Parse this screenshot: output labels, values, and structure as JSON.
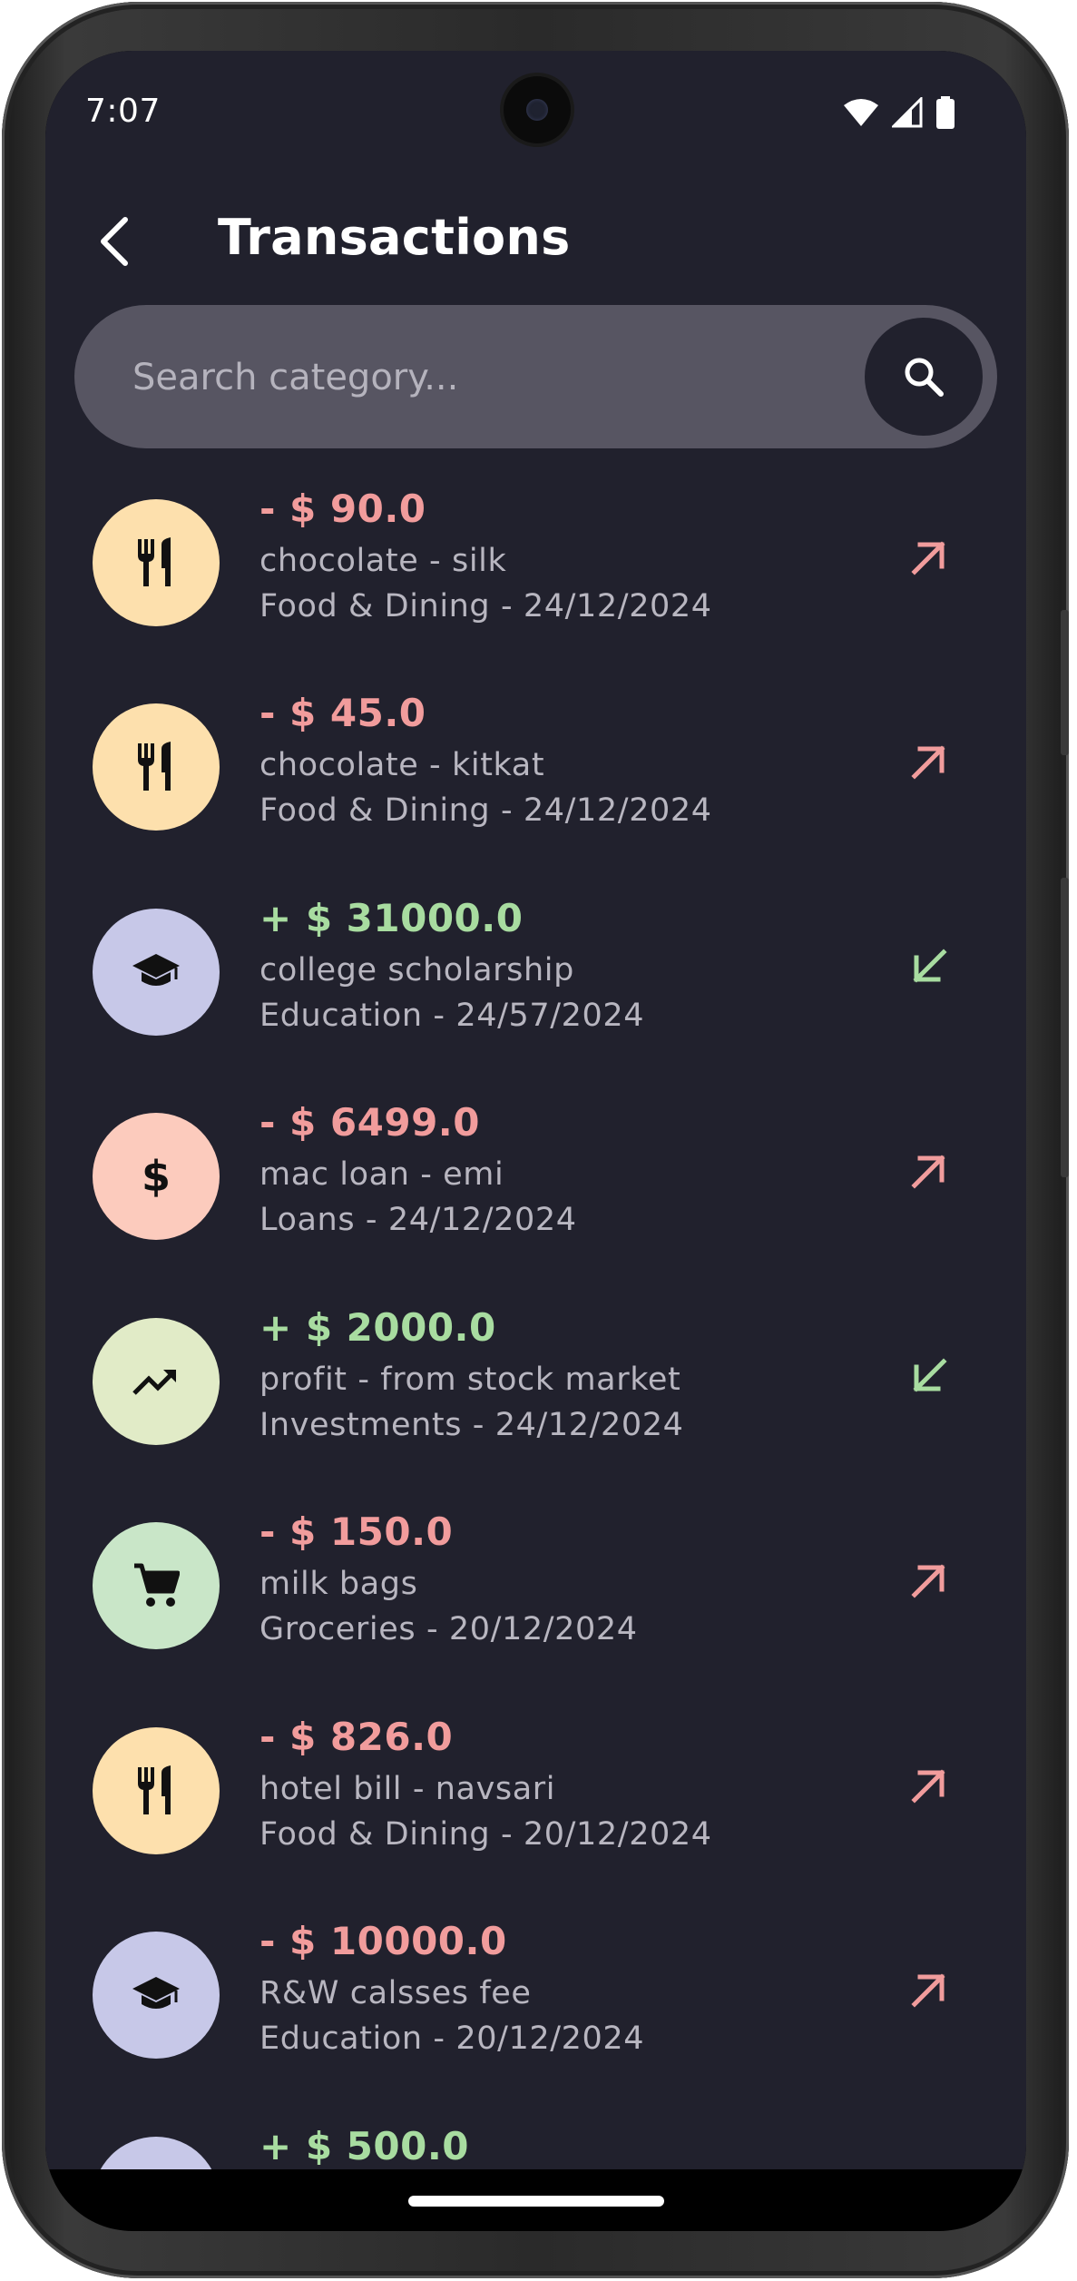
{
  "status": {
    "time": "7:07"
  },
  "header": {
    "title": "Transactions"
  },
  "search": {
    "placeholder": "Search category..."
  },
  "colors": {
    "background": "#21212d",
    "expense": "#f19c9c",
    "income": "#a8dca0",
    "food": "#fde0ad",
    "education": "#c7c8e8",
    "loans": "#fccbbd",
    "investments": "#e1ebc7",
    "groceries": "#c9e6c8"
  },
  "transactions": [
    {
      "amount": "- $ 90.0",
      "description": "chocolate - silk",
      "meta": "Food & Dining - 24/12/2024",
      "type": "expense",
      "icon": "restaurant-icon"
    },
    {
      "amount": "- $ 45.0",
      "description": "chocolate - kitkat",
      "meta": "Food & Dining - 24/12/2024",
      "type": "expense",
      "icon": "restaurant-icon"
    },
    {
      "amount": "+ $ 31000.0",
      "description": "college scholarship",
      "meta": "Education - 24/57/2024",
      "type": "income",
      "icon": "school-icon"
    },
    {
      "amount": "- $ 6499.0",
      "description": "mac loan - emi",
      "meta": "Loans - 24/12/2024",
      "type": "expense",
      "icon": "dollar-icon"
    },
    {
      "amount": "+ $ 2000.0",
      "description": "profit - from stock market",
      "meta": "Investments - 24/12/2024",
      "type": "income",
      "icon": "trending-up-icon"
    },
    {
      "amount": "- $ 150.0",
      "description": "milk bags",
      "meta": "Groceries - 20/12/2024",
      "type": "expense",
      "icon": "cart-icon"
    },
    {
      "amount": "- $ 826.0",
      "description": "hotel bill - navsari",
      "meta": "Food & Dining - 20/12/2024",
      "type": "expense",
      "icon": "restaurant-icon"
    },
    {
      "amount": "- $ 10000.0",
      "description": "R&W calsses fee",
      "meta": "Education - 20/12/2024",
      "type": "expense",
      "icon": "school-icon"
    },
    {
      "amount": "+ $ 500.0",
      "description": "",
      "meta": "",
      "type": "income",
      "icon": "school-icon"
    }
  ]
}
